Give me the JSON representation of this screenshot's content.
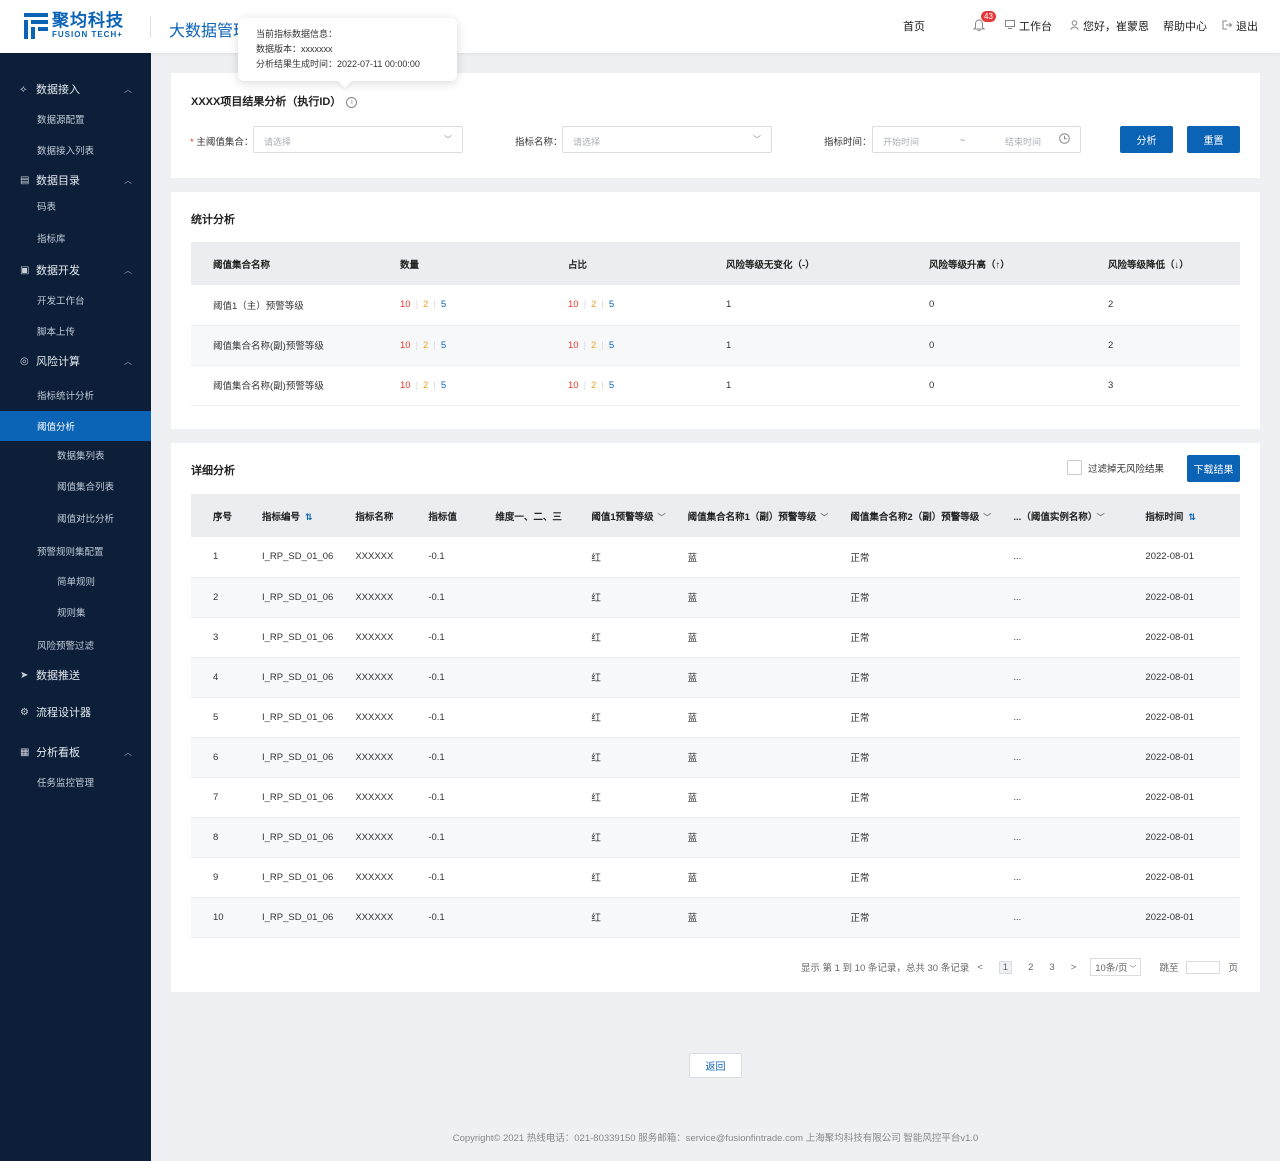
{
  "header": {
    "logo_cn": "聚均科技",
    "logo_en": "FUSION TECH+",
    "app_title": "大数据管理",
    "nav": {
      "home": "首页",
      "badge": "43",
      "workbench": "工作台",
      "greeting": "您好，崔蒙恩",
      "help": "帮助中心",
      "logout": "退出"
    }
  },
  "tooltip": {
    "line1": "当前指标数据信息：",
    "line2": "数据版本：xxxxxxx",
    "line3": "分析结果生成时间：2022-07-11 00:00:00"
  },
  "sidebar": {
    "g1": "数据接入",
    "g1_i1": "数据源配置",
    "g1_i2": "数据接入列表",
    "g2": "数据目录",
    "g2_i1": "码表",
    "g2_i2": "指标库",
    "g3": "数据开发",
    "g3_i1": "开发工作台",
    "g3_i2": "脚本上传",
    "g4": "风险计算",
    "g4_i1": "指标统计分析",
    "g4_i2": "阈值分析",
    "g4_s1": "数据集列表",
    "g4_s2": "阈值集合列表",
    "g4_s3": "阈值对比分析",
    "g4_i3": "预警规则集配置",
    "g4_s4": "简单规则",
    "g4_s5": "规则集",
    "g4_i4": "风险预警过滤",
    "g5": "数据推送",
    "g6": "流程设计器",
    "g7": "分析看板",
    "g7_i1": "任务监控管理"
  },
  "filter": {
    "title": "XXXX项目结果分析（执行ID）",
    "info_icon": "i",
    "required_mark": "*",
    "main_set_label": "主阈值集合：",
    "main_set_placeholder": "请选择",
    "metric_label": "指标名称：",
    "metric_placeholder": "请选择",
    "time_label": "指标时间：",
    "start_placeholder": "开始时间",
    "range_sep": "~",
    "end_placeholder": "结束时间",
    "analyze_btn": "分析",
    "reset_btn": "重置"
  },
  "stats": {
    "title": "统计分析",
    "headers": [
      "阈值集合名称",
      "数量",
      "占比",
      "风险等级无变化（-）",
      "风险等级升高（↑）",
      "风险等级降低（↓）"
    ],
    "rows": [
      {
        "name": "阈值1（主）预警等级",
        "count": [
          "10",
          "2",
          "5"
        ],
        "ratio": [
          "10",
          "2",
          "5"
        ],
        "same": "1",
        "up": "0",
        "down": "2"
      },
      {
        "name": "阈值集合名称(副)预警等级",
        "count": [
          "10",
          "2",
          "5"
        ],
        "ratio": [
          "10",
          "2",
          "5"
        ],
        "same": "1",
        "up": "0",
        "down": "2"
      },
      {
        "name": "阈值集合名称(副)预警等级",
        "count": [
          "10",
          "2",
          "5"
        ],
        "ratio": [
          "10",
          "2",
          "5"
        ],
        "same": "1",
        "up": "0",
        "down": "3"
      }
    ]
  },
  "detail": {
    "title": "详细分析",
    "filter_checkbox": "过滤掉无风险结果",
    "download_btn": "下载结果",
    "headers": [
      "序号",
      "指标编号",
      "指标名称",
      "指标值",
      "维度一、二、三",
      "阈值1预警等级",
      "阈值集合名称1（副）预警等级",
      "阈值集合名称2（副）预警等级",
      "...（阈值实例名称）",
      "指标时间"
    ],
    "rows": [
      [
        "1",
        "I_RP_SD_01_06",
        "XXXXXX",
        "-0.1",
        "",
        "红",
        "蓝",
        "正常",
        "...",
        "2022-08-01"
      ],
      [
        "2",
        "I_RP_SD_01_06",
        "XXXXXX",
        "-0.1",
        "",
        "红",
        "蓝",
        "正常",
        "...",
        "2022-08-01"
      ],
      [
        "3",
        "I_RP_SD_01_06",
        "XXXXXX",
        "-0.1",
        "",
        "红",
        "蓝",
        "正常",
        "...",
        "2022-08-01"
      ],
      [
        "4",
        "I_RP_SD_01_06",
        "XXXXXX",
        "-0.1",
        "",
        "红",
        "蓝",
        "正常",
        "...",
        "2022-08-01"
      ],
      [
        "5",
        "I_RP_SD_01_06",
        "XXXXXX",
        "-0.1",
        "",
        "红",
        "蓝",
        "正常",
        "...",
        "2022-08-01"
      ],
      [
        "6",
        "I_RP_SD_01_06",
        "XXXXXX",
        "-0.1",
        "",
        "红",
        "蓝",
        "正常",
        "...",
        "2022-08-01"
      ],
      [
        "7",
        "I_RP_SD_01_06",
        "XXXXXX",
        "-0.1",
        "",
        "红",
        "蓝",
        "正常",
        "...",
        "2022-08-01"
      ],
      [
        "8",
        "I_RP_SD_01_06",
        "XXXXXX",
        "-0.1",
        "",
        "红",
        "蓝",
        "正常",
        "...",
        "2022-08-01"
      ],
      [
        "9",
        "I_RP_SD_01_06",
        "XXXXXX",
        "-0.1",
        "",
        "红",
        "蓝",
        "正常",
        "...",
        "2022-08-01"
      ],
      [
        "10",
        "I_RP_SD_01_06",
        "XXXXXX",
        "-0.1",
        "",
        "红",
        "蓝",
        "正常",
        "...",
        "2022-08-01"
      ]
    ]
  },
  "pagination": {
    "summary": "显示 第 1 到 10 条记录，总共 30 条记录",
    "prev": "<",
    "pages": [
      "1",
      "2",
      "3"
    ],
    "next": ">",
    "page_size": "10条/页",
    "jump_label": "跳至",
    "page_unit": "页"
  },
  "back_btn": "返回",
  "footer": "Copyright© 2021  热线电话：021-80339150  服务邮箱：service@fusionfintrade.com  上海聚均科技有限公司 智能风控平台v1.0",
  "colors": {
    "brand": "#0b63b6",
    "sidebar_bg": "#0c1e38",
    "red": "#e0392b",
    "orange": "#f0a020"
  }
}
